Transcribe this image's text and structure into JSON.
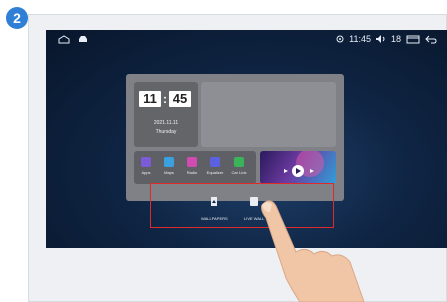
{
  "step": {
    "number": "2"
  },
  "statusbar": {
    "time": "11:45",
    "volume": "18",
    "icons": [
      "home-icon",
      "car-icon",
      "location-icon",
      "volume-icon",
      "window-icon",
      "back-icon"
    ]
  },
  "widgets": {
    "clock": {
      "hour": "11",
      "minute": "45",
      "date": "2021.11.11",
      "weekday": "Thursday"
    },
    "apps": [
      {
        "label": "Apps",
        "icon": "apps-grid-icon",
        "color": "#7b5cd6"
      },
      {
        "label": "Maps",
        "icon": "map-pin-icon",
        "color": "#3aa0e0"
      },
      {
        "label": "Radio",
        "icon": "radio-icon",
        "color": "#d24bb0"
      },
      {
        "label": "Equalizer",
        "icon": "equalizer-icon",
        "color": "#5b61e0"
      },
      {
        "label": "Car Link",
        "icon": "car-link-icon",
        "color": "#3bb35a"
      }
    ]
  },
  "options": {
    "wallpaper": {
      "label": "WALLPAPERS",
      "icon": "wallpaper-icon"
    },
    "live": {
      "label": "LIVE WALL",
      "icon": "live-wallpaper-icon"
    }
  },
  "colors": {
    "badge": "#2f7fd6",
    "highlight": "#e02a2a",
    "screen": "#0f2544"
  }
}
